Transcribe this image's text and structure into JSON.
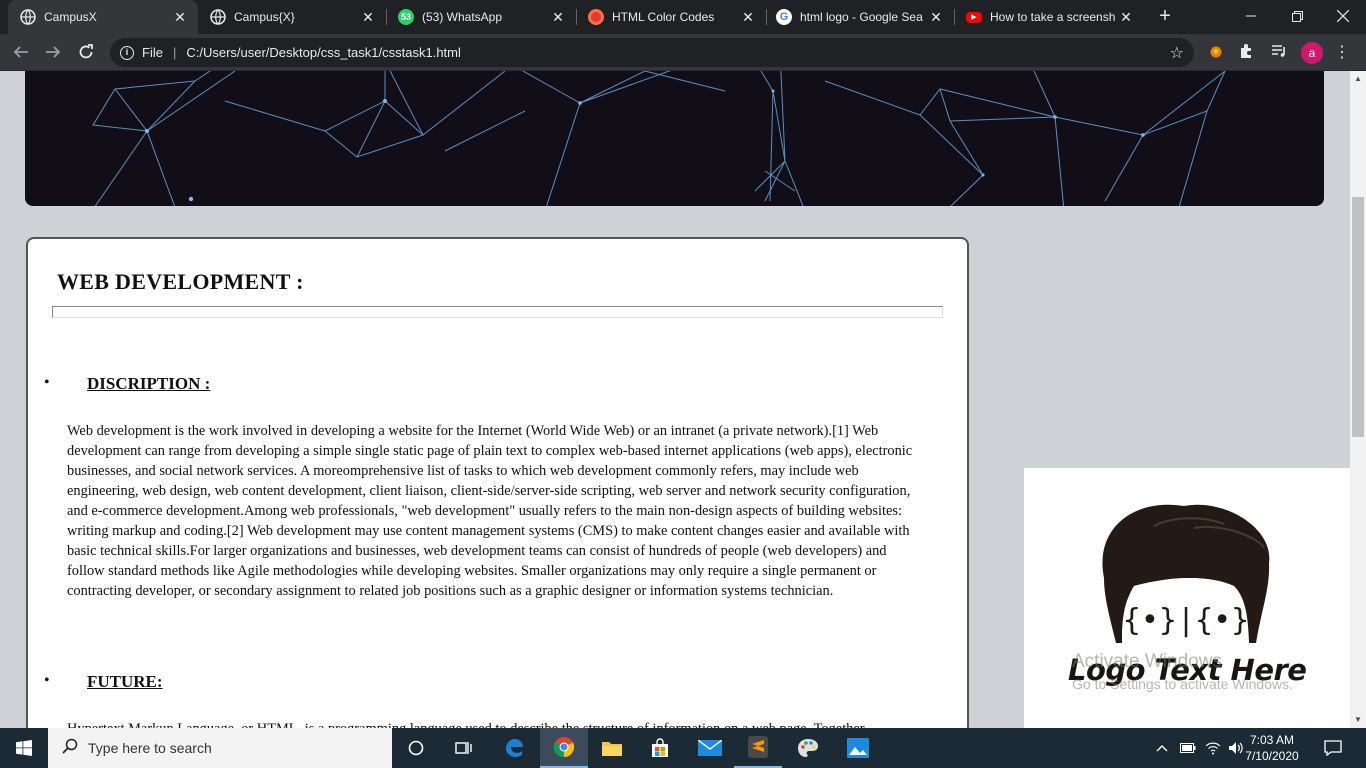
{
  "tabs": [
    {
      "title": "CampusX",
      "favicon": "globe-icon",
      "active": true
    },
    {
      "title": "Campus{X}",
      "favicon": "globe-icon",
      "active": false
    },
    {
      "title": "(53) WhatsApp",
      "favicon": "whatsapp-icon",
      "badge": "53",
      "active": false
    },
    {
      "title": "HTML Color Codes",
      "favicon": "color-codes-icon",
      "active": false
    },
    {
      "title": "html logo - Google Sea",
      "favicon": "google-icon",
      "active": false
    },
    {
      "title": "How to take a screensh",
      "favicon": "youtube-icon",
      "active": false
    }
  ],
  "toolbar": {
    "protocol_label": "File",
    "url": "C:/Users/user/Desktop/css_task1/csstask1.html",
    "profile_initial": "a"
  },
  "content": {
    "title": "WEB DEVELOPMENT :",
    "sections": [
      {
        "heading": "DISCRIPTION :",
        "body": "Web development is the work involved in developing a website for the Internet (World Wide Web) or an intranet (a private network).[1] Web development can range from developing a simple single static page of plain text to complex web-based internet applications (web apps), electronic businesses, and social network services. A moreomprehensive list of tasks to which web development commonly refers, may include web engineering, web design, web content development, client liaison, client-side/server-side scripting, web server and network security configuration, and e-commerce development.Among web professionals, \"web development\" usually refers to the main non-design aspects of building websites: writing markup and coding.[2] Web development may use content management systems (CMS) to make content changes easier and available with basic technical skills.For larger organizations and businesses, web development teams can consist of hundreds of people (web developers) and follow standard methods like Agile methodologies while developing websites. Smaller organizations may only require a single permanent or contracting developer, or secondary assignment to related job positions such as a graphic designer or information systems technician."
      },
      {
        "heading": "FUTURE:",
        "body": "Hypertext Markup Language, or HTML, is a programming language used to describe the structure of information on a web page. Together"
      }
    ],
    "logo": {
      "face_text": "{•}|{•}",
      "text": "Logo Text Here"
    }
  },
  "watermark": {
    "line1": "Activate Windows",
    "line2": "Go to Settings to activate Windows."
  },
  "taskbar": {
    "search_placeholder": "Type here to search",
    "time": "7:03 AM",
    "date": "7/10/2020"
  },
  "colors": {
    "page_background": "#ced1d6",
    "hero_background": "#110e17",
    "hero_lines": "#5b8fc2",
    "profile_avatar": "#d2176e",
    "taskbar": "#1c2a36"
  }
}
